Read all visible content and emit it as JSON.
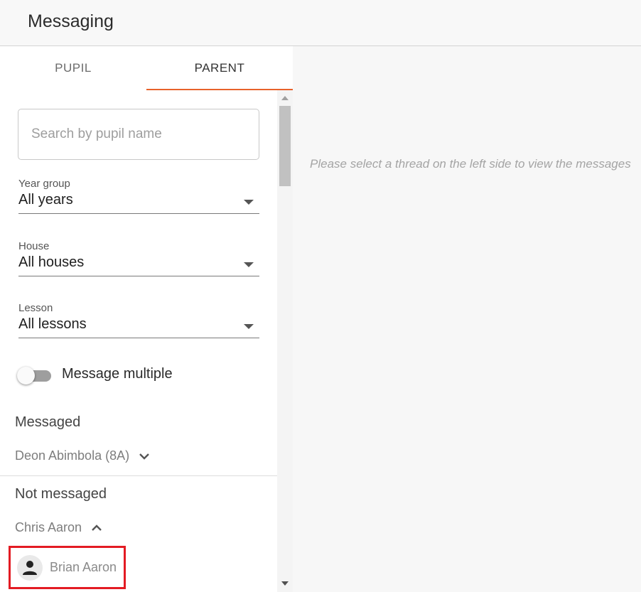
{
  "header": {
    "title": "Messaging"
  },
  "tabs": [
    {
      "label": "PUPIL",
      "active": false
    },
    {
      "label": "PARENT",
      "active": true
    }
  ],
  "accent_color": "#e8622b",
  "search": {
    "placeholder": "Search by pupil name",
    "value": ""
  },
  "filters": {
    "year_group": {
      "label": "Year group",
      "value": "All years"
    },
    "house": {
      "label": "House",
      "value": "All houses"
    },
    "lesson": {
      "label": "Lesson",
      "value": "All lessons"
    }
  },
  "message_multiple": {
    "label": "Message multiple",
    "enabled": false
  },
  "messaged": {
    "heading": "Messaged",
    "threads": [
      {
        "label": "Deon Abimbola (8A)",
        "expanded": false
      }
    ]
  },
  "not_messaged": {
    "heading": "Not messaged",
    "threads": [
      {
        "label": "Chris Aaron",
        "expanded": true,
        "contacts": [
          {
            "name": "Brian Aaron",
            "icon": "person-icon"
          }
        ]
      }
    ]
  },
  "highlight_color": "#e31b23",
  "empty_state": {
    "text": "Please select a thread on the left side to view the messages"
  }
}
